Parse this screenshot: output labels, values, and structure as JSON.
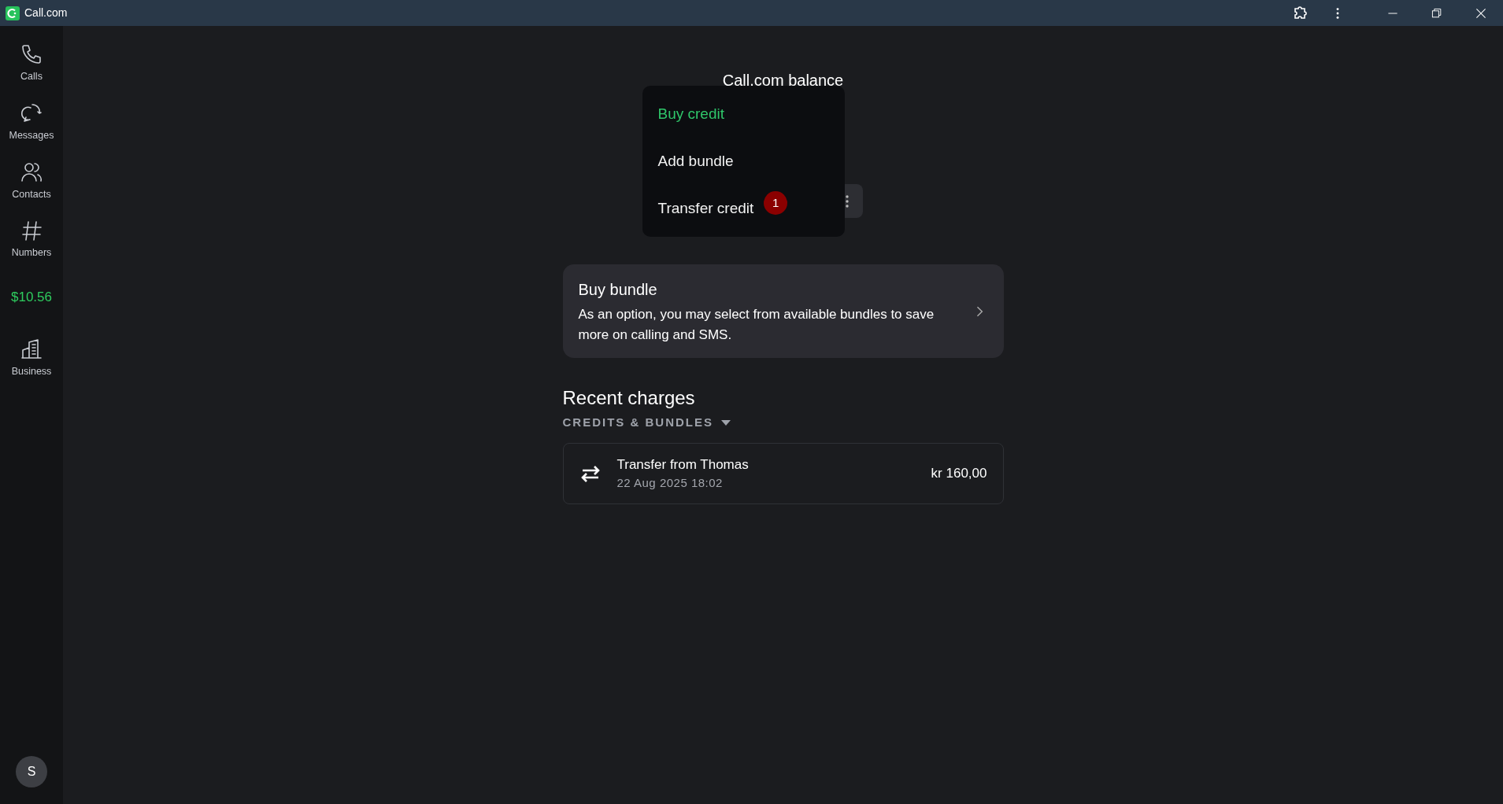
{
  "window": {
    "title": "Call.com"
  },
  "sidebar": {
    "items": [
      {
        "kind": "nav",
        "label": "Calls"
      },
      {
        "kind": "nav",
        "label": "Messages"
      },
      {
        "kind": "nav",
        "label": "Contacts"
      },
      {
        "kind": "nav",
        "label": "Numbers"
      },
      {
        "kind": "balance",
        "label": "$10.56"
      },
      {
        "kind": "nav",
        "label": "Business"
      }
    ],
    "avatar": "S"
  },
  "balance": {
    "title": "Call.com balance"
  },
  "menu": {
    "items": [
      {
        "label": "Buy credit",
        "selected": true
      },
      {
        "label": "Add bundle",
        "selected": false
      },
      {
        "label": "Transfer credit",
        "selected": false,
        "badge": "1"
      }
    ]
  },
  "bundle_card": {
    "title": "Buy bundle",
    "text": "As an option, you may select from available bundles to save more on calling and SMS."
  },
  "recent": {
    "title": "Recent charges",
    "filter": "CREDITS & BUNDLES",
    "rows": [
      {
        "title": "Transfer from Thomas",
        "date": "22 Aug 2025 18:02",
        "amount": "kr 160,00"
      }
    ]
  }
}
